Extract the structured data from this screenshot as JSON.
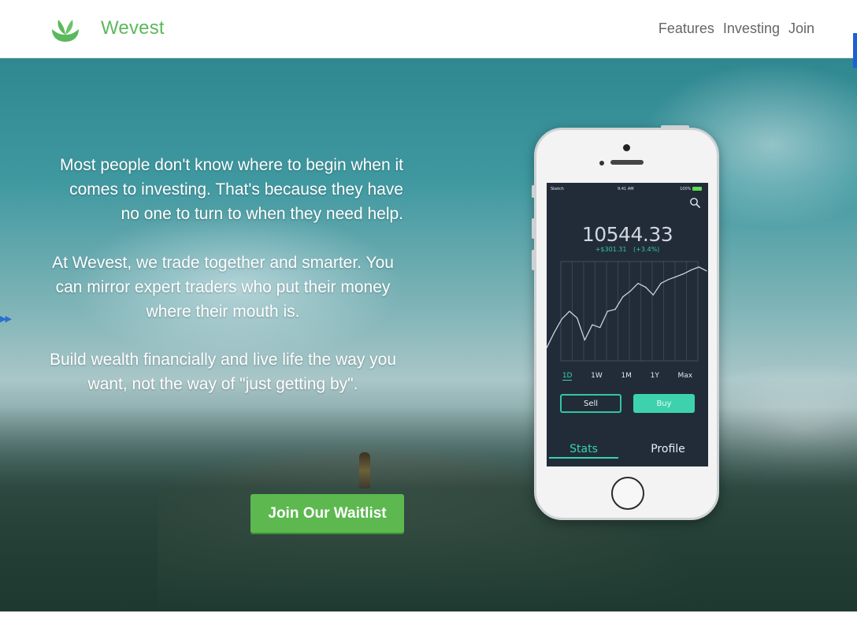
{
  "header": {
    "brand": "Wevest",
    "logo_icon": "leaf-logo",
    "nav": [
      "Features",
      "Investing",
      "Join"
    ]
  },
  "hero": {
    "paragraphs": [
      "Most people don't know where to begin when it comes to investing. That's because they have no one to turn to when they need help.",
      "At Wevest, we trade together and smarter. You can mirror expert traders who put their money where their mouth is.",
      "Build wealth financially and live life the way you want, not the way of \"just getting by\"."
    ],
    "cta": "Join Our Waitlist"
  },
  "phone": {
    "status": {
      "carrier": "Sketch",
      "time": "9:41 AM",
      "battery": "100%"
    },
    "price": "10544.33",
    "change": "+$301.31",
    "change_pct": "(+3.4%)",
    "ranges": [
      "1D",
      "1W",
      "1M",
      "1Y",
      "Max"
    ],
    "selected_range": "1D",
    "sell": "Sell",
    "buy": "Buy",
    "tabs": [
      "Stats",
      "Profile"
    ]
  },
  "colors": {
    "brand_green": "#5cb85c",
    "cta_green": "#5cb84f",
    "accent_teal": "#37d3ad",
    "screen_bg": "#222c39"
  },
  "chart_data": {
    "type": "line",
    "series": [
      {
        "values": [
          0.12,
          0.28,
          0.42,
          0.5,
          0.43,
          0.2,
          0.36,
          0.33,
          0.5,
          0.52,
          0.65,
          0.71,
          0.79,
          0.75,
          0.67,
          0.79,
          0.83,
          0.86,
          0.89,
          0.93,
          0.96,
          0.92
        ]
      }
    ],
    "ylim": [
      0,
      1
    ],
    "grid": true
  }
}
